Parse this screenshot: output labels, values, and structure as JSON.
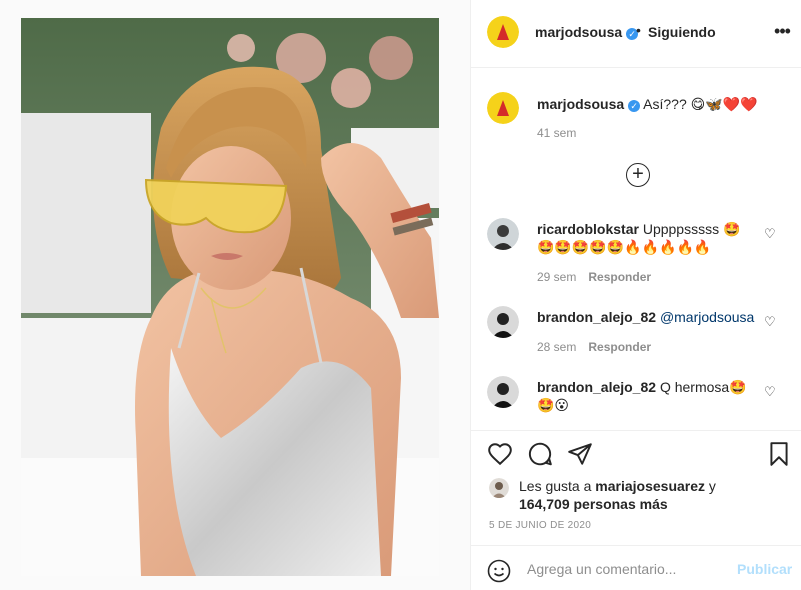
{
  "post": {
    "image_alt": "Foto de mujer con gafas amarillas y traje de baño plateado"
  },
  "header": {
    "username": "marjodsousa",
    "separator": "•",
    "follow_state": "Siguiendo",
    "more": "•••"
  },
  "caption": {
    "username": "marjodsousa",
    "text": "Así??? 😋🦋❤️❤️",
    "time": "41 sem"
  },
  "comments": [
    {
      "username": "ricardoblokstar",
      "text": "Uppppsssss 🤩 🤩🤩🤩🤩🤩🔥🔥🔥🔥🔥",
      "time": "29 sem",
      "reply": "Responder"
    },
    {
      "username": "brandon_alejo_82",
      "text": "@marjodsousa",
      "time": "28 sem",
      "reply": "Responder"
    },
    {
      "username": "brandon_alejo_82",
      "text": "Q hermosa🤩 🤩😮"
    }
  ],
  "likes": {
    "prefix": "Les gusta a",
    "liker": "mariajosesuarez",
    "conj": "y",
    "others": "164,709 personas más"
  },
  "date": "5 DE JUNIO DE 2020",
  "add_comment": {
    "placeholder": "Agrega un comentario...",
    "post_label": "Publicar"
  },
  "colors": {
    "verified": "#3897f0",
    "post_button_disabled": "#b2dffc",
    "mention": "#00376b",
    "muted": "#8e8e8e"
  },
  "icons": [
    "more-icon",
    "plus-circle-icon",
    "heart-icon",
    "comment-icon",
    "share-icon",
    "bookmark-icon",
    "emoji-icon",
    "verified-icon"
  ]
}
